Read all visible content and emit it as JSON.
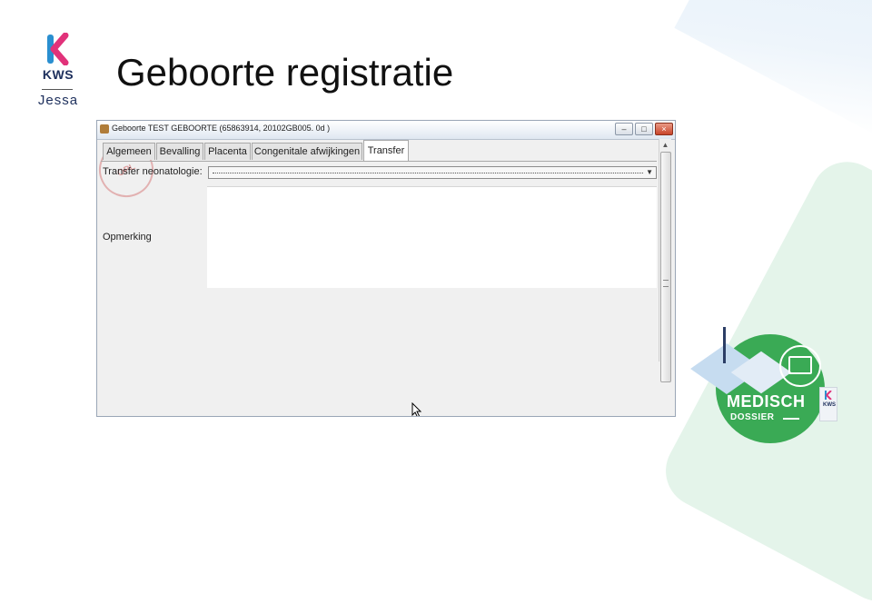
{
  "slide": {
    "title": "Geboorte registratie"
  },
  "logo": {
    "kws_text": "KWS",
    "jessa_text": "Jessa",
    "k_colors": [
      "#e1327a",
      "#2a8fd0"
    ]
  },
  "window": {
    "title": "Geboorte    TEST GEBOORTE (65863914, 20102GB005. 0d )",
    "icon": "app-icon",
    "controls": [
      "minimize",
      "maximize",
      "close"
    ],
    "tabs": [
      {
        "label": "Algemeen",
        "active": false
      },
      {
        "label": "Bevalling",
        "active": false
      },
      {
        "label": "Placenta",
        "active": false
      },
      {
        "label": "Congenitale afwijkingen",
        "active": false
      },
      {
        "label": "Transfer",
        "active": true
      }
    ],
    "fields": {
      "transfer_label": "Transfer neonatologie:",
      "transfer_value": "",
      "opmerking_label": "Opmerking",
      "opmerking_value": ""
    },
    "stamp_text": "OPL"
  },
  "badge": {
    "title": "MEDISCH",
    "subtitle": "DOSSIER",
    "mini_logo_text": "KWS",
    "color": "#3aaa55"
  },
  "colors": {
    "navy": "#1d2f5c",
    "green": "#3aaa55"
  }
}
